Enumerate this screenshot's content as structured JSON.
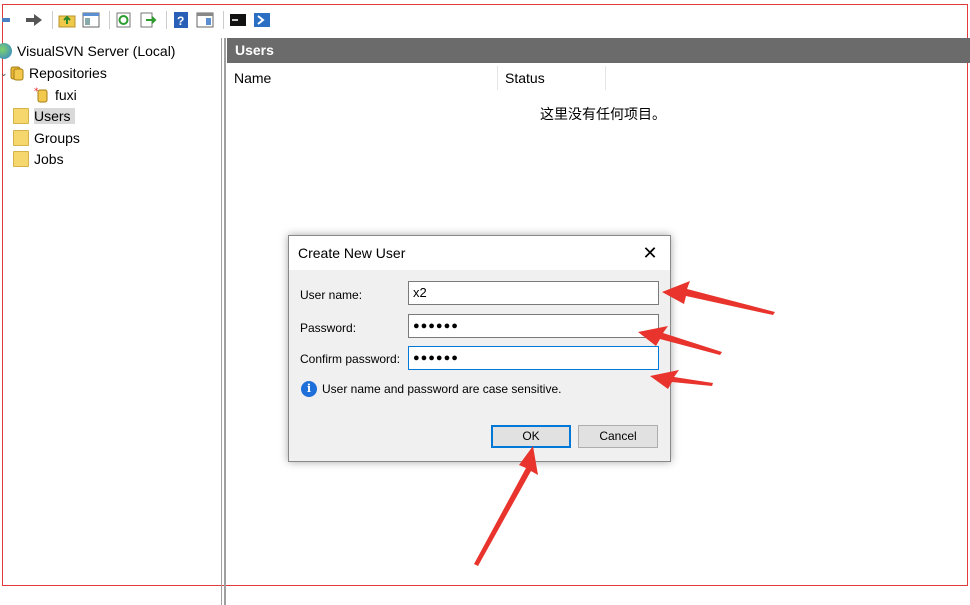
{
  "toolbar": {
    "icons": [
      "arrow-left-icon",
      "arrow-right-icon",
      "folder-up-icon",
      "console-tree-icon",
      "refresh-icon",
      "export-icon",
      "help-icon",
      "properties-icon",
      "cmd-icon",
      "powershell-icon"
    ]
  },
  "tree": {
    "root": "VisualSVN Server (Local)",
    "repositories": "Repositories",
    "repo_fuxi": "fuxi",
    "users": "Users",
    "groups": "Groups",
    "jobs": "Jobs"
  },
  "pane": {
    "title": "Users",
    "col_name": "Name",
    "col_status": "Status",
    "empty_text": "这里没有任何项目。"
  },
  "dialog": {
    "title": "Create New User",
    "close": "✕",
    "username_label": "User name:",
    "username_value": "x2",
    "password_label": "Password:",
    "password_value": "●●●●●●",
    "confirm_label": "Confirm password:",
    "confirm_value": "●●●●●●",
    "info_text": "User name and password are case sensitive.",
    "ok_label": "OK",
    "cancel_label": "Cancel"
  },
  "colors": {
    "annotation_arrow": "#e8342c",
    "header_bg": "#6b6b6b",
    "focus_border": "#0078d7"
  }
}
